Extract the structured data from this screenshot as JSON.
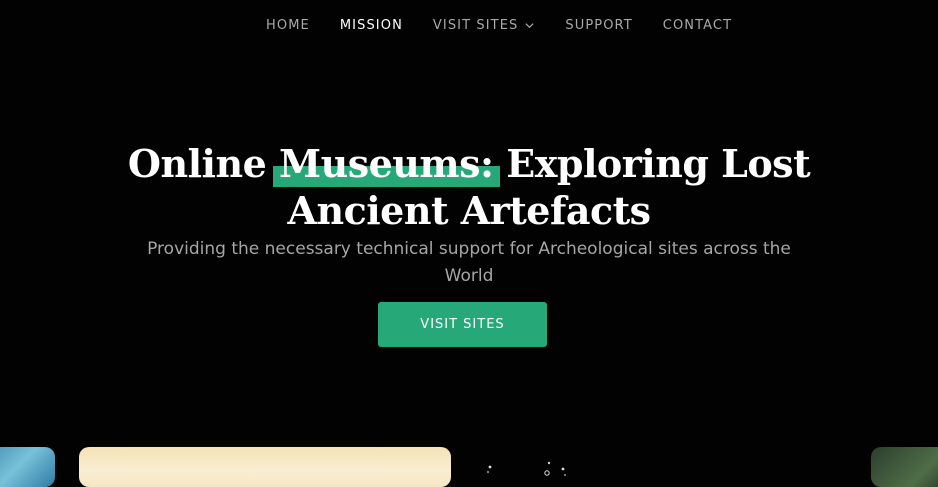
{
  "nav": {
    "items": [
      {
        "label": "HOME"
      },
      {
        "label": "MISSION"
      },
      {
        "label": "VISIT SITES"
      },
      {
        "label": "SUPPORT"
      },
      {
        "label": "CONTACT"
      }
    ]
  },
  "hero": {
    "title_pre": "Online",
    "title_highlight": "Museums:",
    "title_post": "Exploring Lost",
    "title_line2": "Ancient Artefacts",
    "subtitle": "Providing the necessary technical support for Archeological sites across the World",
    "cta_label": "VISIT SITES"
  },
  "colors": {
    "background": "#020202",
    "accent": "#27a878",
    "nav_inactive": "#a9a9a9",
    "subtitle": "#a6a6a6"
  }
}
